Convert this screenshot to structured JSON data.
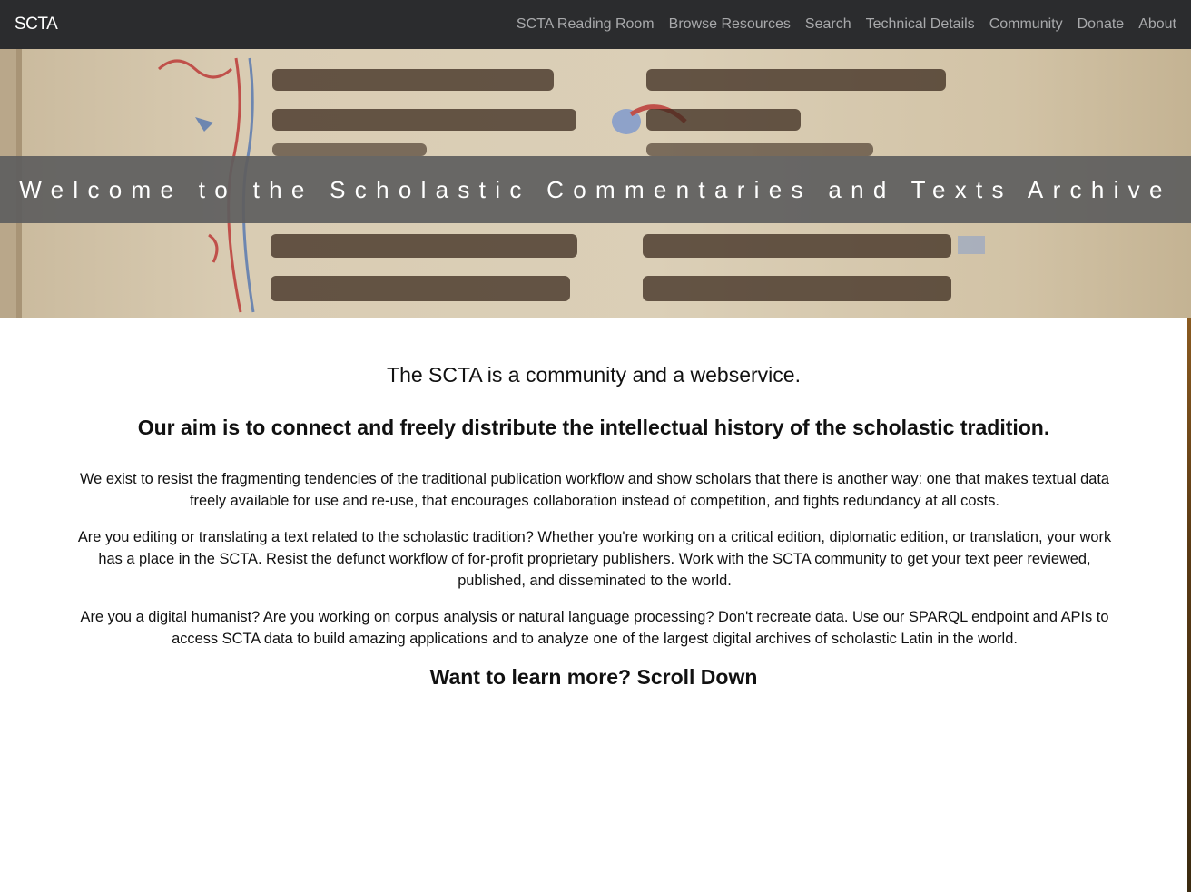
{
  "navbar": {
    "brand": "SCTA",
    "links": [
      {
        "label": "SCTA Reading Room"
      },
      {
        "label": "Browse Resources"
      },
      {
        "label": "Search"
      },
      {
        "label": "Technical Details"
      },
      {
        "label": "Community"
      },
      {
        "label": "Donate"
      },
      {
        "label": "About"
      }
    ]
  },
  "hero": {
    "title": "Welcome to the Scholastic Commentaries and Texts Archive",
    "band_color": "#5f5f5f",
    "parchment_color": "#d6c8ad"
  },
  "main": {
    "lead_1": "The SCTA is a community and a webservice.",
    "lead_2": "Our aim is to connect and freely distribute the intellectual history of the scholastic tradition.",
    "paragraphs": [
      "We exist to resist the fragmenting tendencies of the traditional publication workflow and show scholars that there is another way: one that makes textual data freely available for use and re-use, that encourages collaboration instead of competition, and fights redundancy at all costs.",
      "Are you editing or translating a text related to the scholastic tradition? Whether you're working on a critical edition, diplomatic edition, or translation, your work has a place in the SCTA. Resist the defunct workflow of for-profit proprietary publishers. Work with the SCTA community to get your text peer reviewed, published, and disseminated to the world.",
      "Are you a digital humanist? Are you working on corpus analysis or natural language processing? Don't recreate data. Use our SPARQL endpoint and APIs to access SCTA data to build amazing applications and to analyze one of the largest digital archives of scholastic Latin in the world."
    ],
    "learn_more": "Want to learn more? Scroll Down"
  },
  "colors": {
    "navbar_bg": "#2b2c2e",
    "nav_link": "#a8a9ab",
    "brand": "#ffffff"
  }
}
